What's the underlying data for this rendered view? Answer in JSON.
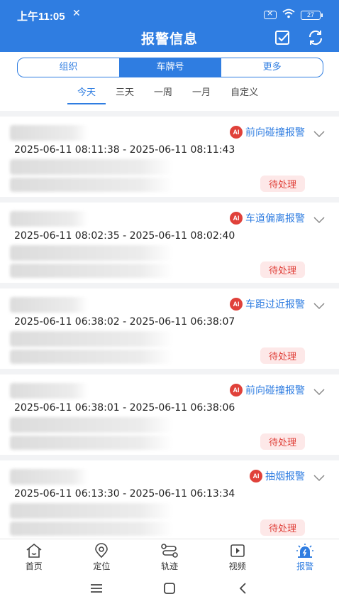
{
  "status_bar": {
    "time": "上午11:05",
    "battery": "27"
  },
  "header": {
    "title": "报警信息"
  },
  "segments": [
    {
      "label": "组织",
      "active": false
    },
    {
      "label": "车牌号",
      "active": true
    },
    {
      "label": "更多",
      "active": false
    }
  ],
  "time_tabs": [
    {
      "label": "今天",
      "active": true
    },
    {
      "label": "三天",
      "active": false
    },
    {
      "label": "一周",
      "active": false
    },
    {
      "label": "一月",
      "active": false
    },
    {
      "label": "自定义",
      "active": false
    }
  ],
  "alarms": [
    {
      "badge": "AI",
      "type": "前向碰撞报警",
      "time_range": "2025-06-11 08:11:38 - 2025-06-11 08:11:43",
      "status": "待处理"
    },
    {
      "badge": "AI",
      "type": "车道偏离报警",
      "time_range": "2025-06-11 08:02:35 - 2025-06-11 08:02:40",
      "status": "待处理"
    },
    {
      "badge": "AI",
      "type": "车距过近报警",
      "time_range": "2025-06-11 06:38:02 - 2025-06-11 06:38:07",
      "status": "待处理"
    },
    {
      "badge": "AI",
      "type": "前向碰撞报警",
      "time_range": "2025-06-11 06:38:01 - 2025-06-11 06:38:06",
      "status": "待处理"
    },
    {
      "badge": "AI",
      "type": "抽烟报警",
      "time_range": "2025-06-11 06:13:30 - 2025-06-11 06:13:34",
      "status": "待处理"
    }
  ],
  "nav": [
    {
      "label": "首页",
      "icon": "home-icon",
      "active": false
    },
    {
      "label": "定位",
      "icon": "location-icon",
      "active": false
    },
    {
      "label": "轨迹",
      "icon": "track-icon",
      "active": false
    },
    {
      "label": "视频",
      "icon": "video-icon",
      "active": false
    },
    {
      "label": "报警",
      "icon": "alarm-icon",
      "active": true
    }
  ],
  "colors": {
    "primary": "#2f7de1",
    "alert_red": "#e0413a",
    "pending_bg": "#fde8e8"
  }
}
